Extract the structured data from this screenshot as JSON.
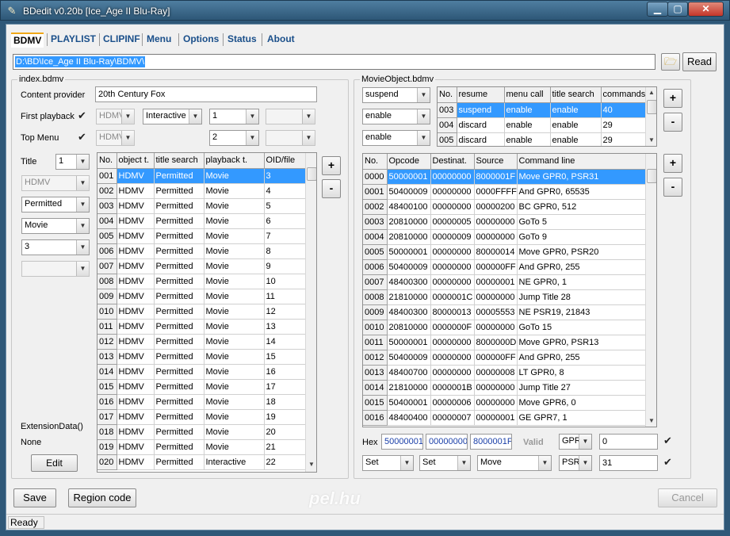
{
  "window": {
    "title": "BDedit v0.20b [Ice_Age II Blu-Ray]",
    "min": "▁",
    "max": "▢",
    "close": "✕"
  },
  "menu": [
    "BDMV",
    "PLAYLIST",
    "CLIPINF",
    "Menu",
    "Options",
    "Status",
    "About"
  ],
  "path": {
    "value": "D:\\BD\\Ice_Age II Blu-Ray\\BDMV\\",
    "read_label": "Read",
    "open_icon": "folder-open-icon"
  },
  "index": {
    "group_title": "index.bdmv",
    "content_provider_label": "Content provider",
    "content_provider": "20th Century Fox",
    "first_playback_label": "First playback",
    "first_playback": {
      "checked": "✔",
      "type": "HDMV",
      "mode": "Interactive",
      "number": "1",
      "extra": ""
    },
    "top_menu_label": "Top Menu",
    "top_menu": {
      "checked": "✔",
      "type": "HDMV",
      "number": "2",
      "extra": ""
    },
    "title_label": "Title",
    "title_number": "1",
    "title_type": "HDMV",
    "title_search": "Permitted",
    "playback_type": "Movie",
    "oid": "3",
    "extra_combo": "",
    "ext_label": "ExtensionData()",
    "ext_value": "None",
    "edit_label": "Edit",
    "plus": "+",
    "minus": "-",
    "columns": [
      "No.",
      "object t.",
      "title search",
      "playback t.",
      "OID/file"
    ],
    "rows": [
      [
        "001",
        "HDMV",
        "Permitted",
        "Movie",
        "3"
      ],
      [
        "002",
        "HDMV",
        "Permitted",
        "Movie",
        "4"
      ],
      [
        "003",
        "HDMV",
        "Permitted",
        "Movie",
        "5"
      ],
      [
        "004",
        "HDMV",
        "Permitted",
        "Movie",
        "6"
      ],
      [
        "005",
        "HDMV",
        "Permitted",
        "Movie",
        "7"
      ],
      [
        "006",
        "HDMV",
        "Permitted",
        "Movie",
        "8"
      ],
      [
        "007",
        "HDMV",
        "Permitted",
        "Movie",
        "9"
      ],
      [
        "008",
        "HDMV",
        "Permitted",
        "Movie",
        "10"
      ],
      [
        "009",
        "HDMV",
        "Permitted",
        "Movie",
        "11"
      ],
      [
        "010",
        "HDMV",
        "Permitted",
        "Movie",
        "12"
      ],
      [
        "011",
        "HDMV",
        "Permitted",
        "Movie",
        "13"
      ],
      [
        "012",
        "HDMV",
        "Permitted",
        "Movie",
        "14"
      ],
      [
        "013",
        "HDMV",
        "Permitted",
        "Movie",
        "15"
      ],
      [
        "014",
        "HDMV",
        "Permitted",
        "Movie",
        "16"
      ],
      [
        "015",
        "HDMV",
        "Permitted",
        "Movie",
        "17"
      ],
      [
        "016",
        "HDMV",
        "Permitted",
        "Movie",
        "18"
      ],
      [
        "017",
        "HDMV",
        "Permitted",
        "Movie",
        "19"
      ],
      [
        "018",
        "HDMV",
        "Permitted",
        "Movie",
        "20"
      ],
      [
        "019",
        "HDMV",
        "Permitted",
        "Movie",
        "21"
      ],
      [
        "020",
        "HDMV",
        "Permitted",
        "Interactive",
        "22"
      ]
    ]
  },
  "movie": {
    "group_title": "MovieObject.bdmv",
    "resume_combo": "suspend",
    "menu_call_combo": "enable",
    "title_search_combo": "enable",
    "obj_columns": [
      "No.",
      "resume",
      "menu call",
      "title search",
      "commands"
    ],
    "obj_rows": [
      [
        "003",
        "suspend",
        "enable",
        "enable",
        "40"
      ],
      [
        "004",
        "discard",
        "enable",
        "enable",
        "29"
      ],
      [
        "005",
        "discard",
        "enable",
        "enable",
        "29"
      ]
    ],
    "cmd_columns": [
      "No.",
      "Opcode",
      "Destinat.",
      "Source",
      "Command line"
    ],
    "cmd_rows": [
      [
        "0000",
        "50000001",
        "00000000",
        "8000001F",
        "Move GPR0, PSR31"
      ],
      [
        "0001",
        "50400009",
        "00000000",
        "0000FFFF",
        "And GPR0, 65535"
      ],
      [
        "0002",
        "48400100",
        "00000000",
        "00000200",
        "BC GPR0, 512"
      ],
      [
        "0003",
        "20810000",
        "00000005",
        "00000000",
        "GoTo 5"
      ],
      [
        "0004",
        "20810000",
        "00000009",
        "00000000",
        "GoTo 9"
      ],
      [
        "0005",
        "50000001",
        "00000000",
        "80000014",
        "Move GPR0, PSR20"
      ],
      [
        "0006",
        "50400009",
        "00000000",
        "000000FF",
        "And GPR0, 255"
      ],
      [
        "0007",
        "48400300",
        "00000000",
        "00000001",
        "NE GPR0, 1"
      ],
      [
        "0008",
        "21810000",
        "0000001C",
        "00000000",
        "Jump Title 28"
      ],
      [
        "0009",
        "48400300",
        "80000013",
        "00005553",
        "NE PSR19, 21843"
      ],
      [
        "0010",
        "20810000",
        "0000000F",
        "00000000",
        "GoTo 15"
      ],
      [
        "0011",
        "50000001",
        "00000000",
        "8000000D",
        "Move GPR0, PSR13"
      ],
      [
        "0012",
        "50400009",
        "00000000",
        "000000FF",
        "And GPR0, 255"
      ],
      [
        "0013",
        "48400700",
        "00000000",
        "00000008",
        "LT GPR0, 8"
      ],
      [
        "0014",
        "21810000",
        "0000001B",
        "00000000",
        "Jump Title 27"
      ],
      [
        "0015",
        "50400001",
        "00000006",
        "00000000",
        "Move GPR6, 0"
      ],
      [
        "0016",
        "48400400",
        "00000007",
        "00000001",
        "GE GPR7, 1"
      ]
    ],
    "hex_label": "Hex",
    "hex": [
      "50000001",
      "00000000",
      "8000001F"
    ],
    "valid_label": "Valid",
    "dest_reg": "GPR",
    "dest_val": "0",
    "src_reg": "PSR",
    "src_val": "31",
    "check1": "✔",
    "check2": "✔",
    "op_group": "Set",
    "op_sub": "Set",
    "op_name": "Move"
  },
  "footer": {
    "save": "Save",
    "region": "Region code",
    "cancel": "Cancel",
    "status": "Ready",
    "watermark": "pel.hu"
  }
}
